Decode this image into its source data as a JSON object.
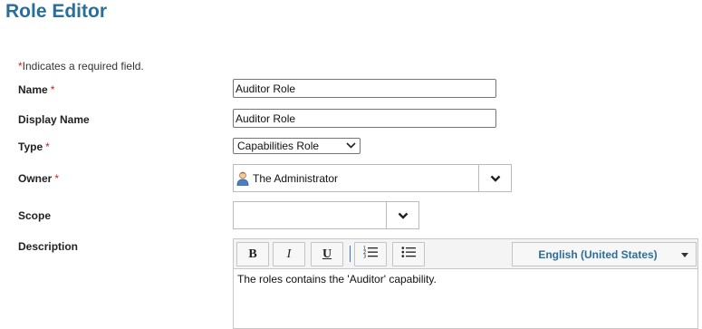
{
  "page": {
    "title": "Role Editor"
  },
  "form": {
    "required_note_star": "*",
    "required_note": "Indicates a required field.",
    "required_star": "*",
    "name": {
      "label": "Name",
      "value": "Auditor Role"
    },
    "display_name": {
      "label": "Display Name",
      "value": "Auditor Role"
    },
    "type": {
      "label": "Type",
      "value": "Capabilities Role"
    },
    "owner": {
      "label": "Owner",
      "value": "The Administrator",
      "icon": "person-icon"
    },
    "scope": {
      "label": "Scope",
      "value": ""
    },
    "description": {
      "label": "Description",
      "toolbar": {
        "bold": "B",
        "italic": "I",
        "underline": "U",
        "language": "English (United States)"
      },
      "text": "The roles contains the 'Auditor' capability."
    }
  },
  "colors": {
    "title": "#2a6e9a",
    "required": "#cc2222",
    "language": "#2a6e9a"
  }
}
